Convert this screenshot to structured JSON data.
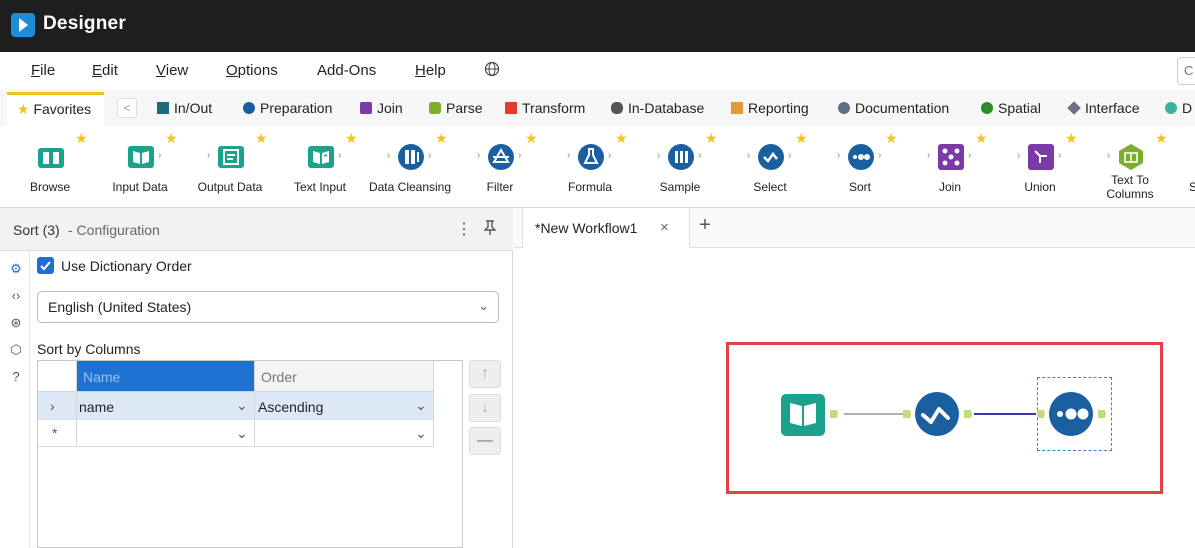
{
  "app": {
    "title": "Designer"
  },
  "menu": [
    "File",
    "Edit",
    "View",
    "Options",
    "Add-Ons",
    "Help"
  ],
  "search_stub": "C",
  "favorites_tab": "Favorites",
  "category_tabs": [
    {
      "label": "In/Out",
      "color": "#1e6a7a"
    },
    {
      "label": "Preparation",
      "color": "#1a5fa0"
    },
    {
      "label": "Join",
      "color": "#7a3aa8"
    },
    {
      "label": "Parse",
      "color": "#7cae2e"
    },
    {
      "label": "Transform",
      "color": "#e53b2b"
    },
    {
      "label": "In-Database",
      "color": "#555555"
    },
    {
      "label": "Reporting",
      "color": "#e29a3a"
    },
    {
      "label": "Documentation",
      "color": "#5e6f88"
    },
    {
      "label": "Spatial",
      "color": "#2d8a2d"
    },
    {
      "label": "Interface",
      "color": "#6f6f88"
    },
    {
      "label": "D",
      "color": "#39b0a0"
    }
  ],
  "tools": [
    {
      "label": "Browse",
      "icon": "binoculars-icon",
      "color": "#1aa28c"
    },
    {
      "label": "Input Data",
      "icon": "book-icon",
      "color": "#1aa28c"
    },
    {
      "label": "Output Data",
      "icon": "output-icon",
      "color": "#1aa28c"
    },
    {
      "label": "Text Input",
      "icon": "book-text-icon",
      "color": "#1aa28c"
    },
    {
      "label": "Data Cleansing",
      "icon": "cleansing-icon",
      "color": "#1a5fa0"
    },
    {
      "label": "Filter",
      "icon": "filter-icon",
      "color": "#1a5fa0"
    },
    {
      "label": "Formula",
      "icon": "flask-icon",
      "color": "#1a5fa0"
    },
    {
      "label": "Sample",
      "icon": "sample-icon",
      "color": "#1a5fa0"
    },
    {
      "label": "Select",
      "icon": "select-icon",
      "color": "#1a5fa0"
    },
    {
      "label": "Sort",
      "icon": "sort-icon",
      "color": "#1a5fa0"
    },
    {
      "label": "Join",
      "icon": "join-icon",
      "color": "#7a3aa8"
    },
    {
      "label": "Union",
      "icon": "union-icon",
      "color": "#7a3aa8"
    },
    {
      "label": "Text To\nColumns",
      "icon": "text-to-columns-icon",
      "color": "#7cae2e"
    },
    {
      "label": "S",
      "icon": "",
      "color": "#7cae2e"
    }
  ],
  "config": {
    "tool_name": "Sort (3)",
    "subtitle": "- Configuration",
    "dictionary_order_label": "Use Dictionary Order",
    "dictionary_order_checked": true,
    "language": "English (United States)",
    "sort_by_label": "Sort by Columns",
    "columns": {
      "name": "Name",
      "order": "Order"
    },
    "rows": [
      {
        "marker": "›",
        "name": "name",
        "order": "Ascending"
      },
      {
        "marker": "*",
        "name": "",
        "order": ""
      }
    ]
  },
  "workflow": {
    "tab_label": "*New Workflow1",
    "nodes": [
      "Input Data",
      "Select",
      "Sort"
    ]
  }
}
